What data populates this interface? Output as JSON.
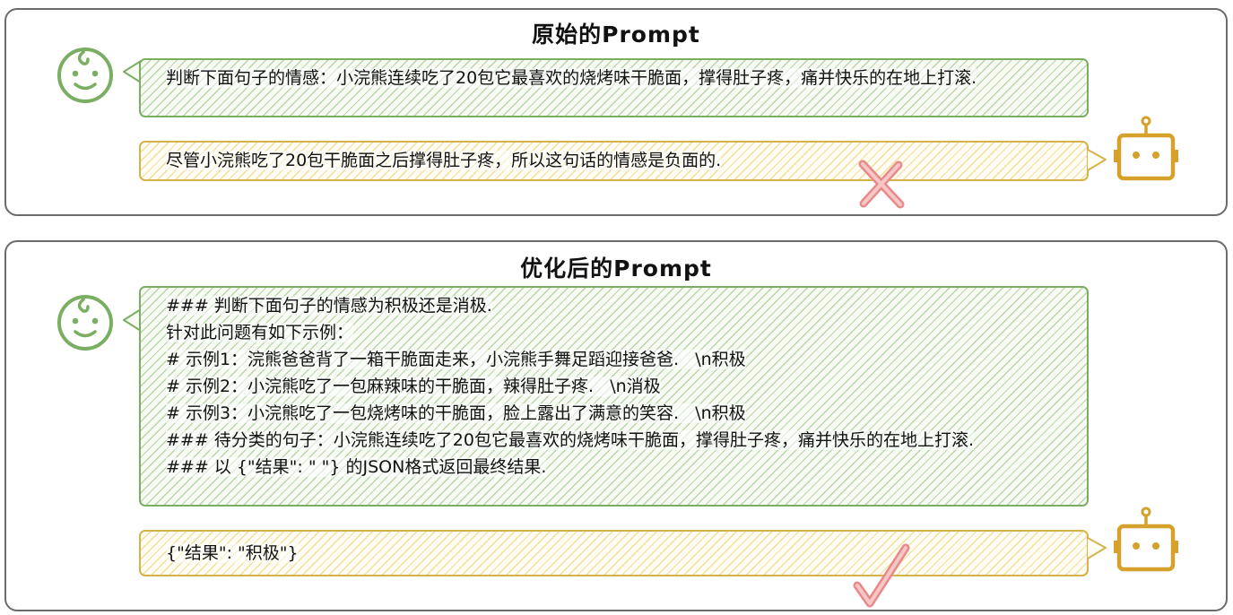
{
  "panels": [
    {
      "title": "原始的Prompt",
      "user_text": "判断下面句子的情感：小浣熊连续吃了20包它最喜欢的烧烤味干脆面，撑得肚子疼，痛并快乐的在地上打滚.",
      "bot_text": "尽管小浣熊吃了20包干脆面之后撑得肚子疼，所以这句话的情感是负面的."
    },
    {
      "title": "优化后的Prompt",
      "user_lines": [
        "### 判断下面句子的情感为积极还是消极.",
        "针对此问题有如下示例：",
        "# 示例1：浣熊爸爸背了一箱干脆面走来，小浣熊手舞足蹈迎接爸爸.   \\n积极",
        "# 示例2：小浣熊吃了一包麻辣味的干脆面，辣得肚子疼.   \\n消极",
        "# 示例3：小浣熊吃了一包烧烤味的干脆面，脸上露出了满意的笑容.   \\n积极",
        "### 待分类的句子：小浣熊连续吃了20包它最喜欢的烧烤味干脆面，撑得肚子疼，痛并快乐的在地上打滚.",
        "### 以 {\"结果\": \" \"} 的JSON格式返回最终结果."
      ],
      "bot_text": "{\"结果\": \"积极\"}"
    }
  ],
  "icons": {
    "user": "baby-face-icon",
    "bot": "robot-icon",
    "wrong": "cross-mark-icon",
    "right": "check-mark-icon"
  },
  "colors": {
    "user": "#7aae62",
    "bot": "#d6a12a",
    "wrong": "#e88a8a",
    "right": "#e88a8a",
    "border": "#6b6b6b"
  }
}
